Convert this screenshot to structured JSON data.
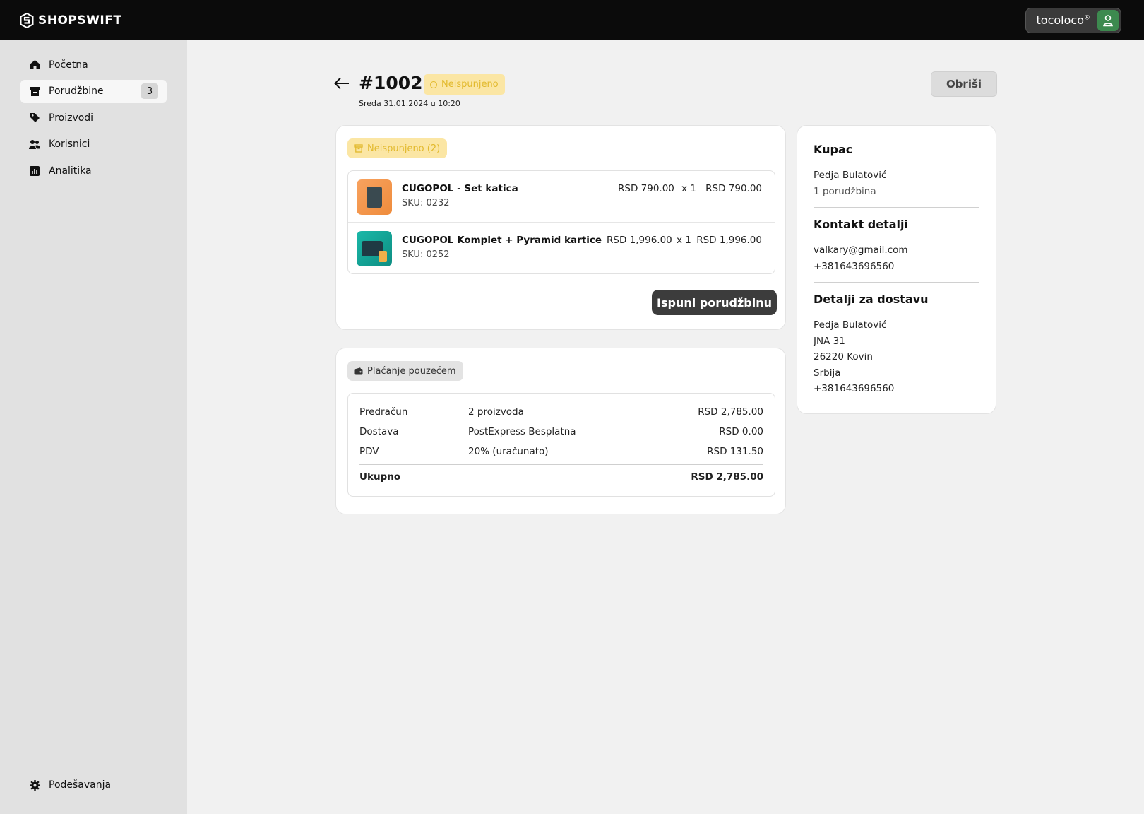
{
  "brand": {
    "name": "SHOPSWIFT"
  },
  "user": {
    "name": "tocoloco",
    "mark": "®"
  },
  "sidebar": {
    "items": [
      {
        "label": "Početna",
        "icon": "home-icon"
      },
      {
        "label": "Porudžbine",
        "icon": "archive-icon",
        "count": "3",
        "active": true
      },
      {
        "label": "Proizvodi",
        "icon": "tag-icon"
      },
      {
        "label": "Korisnici",
        "icon": "users-icon"
      },
      {
        "label": "Analitika",
        "icon": "chart-icon"
      }
    ],
    "settings": {
      "label": "Podešavanja",
      "icon": "gear-icon"
    }
  },
  "order": {
    "number": "#1002",
    "status": "Neispunjeno",
    "date": "Sreda 31.01.2024 u 10:20",
    "delete_label": "Obriši"
  },
  "items_card": {
    "pill": "Neispunjeno (2)",
    "items": [
      {
        "name": "CUGOPOL - Set katica",
        "sku": "SKU: 0232",
        "unit_price": "RSD  790.00",
        "qty": "x  1",
        "total": "RSD 790.00",
        "thumb_color": "#f29a52"
      },
      {
        "name": "CUGOPOL Komplet + Pyramid kartice",
        "sku": "SKU: 0252",
        "unit_price": "RSD  1,996.00",
        "qty": "x  1",
        "total": "RSD 1,996.00",
        "thumb_color": "#14a89a"
      }
    ],
    "fulfill_label": "Ispuni porudžbinu"
  },
  "payment_card": {
    "pill": "Plaćanje pouzećem",
    "rows": [
      {
        "label": "Predračun",
        "detail": "2 proizvoda",
        "amount": "RSD 2,785.00"
      },
      {
        "label": "Dostava",
        "detail": "PostExpress Besplatna",
        "amount": "RSD 0.00"
      },
      {
        "label": "PDV",
        "detail": "20% (uračunato)",
        "amount": "RSD 131.50"
      }
    ],
    "total": {
      "label": "Ukupno",
      "amount": "RSD 2,785.00"
    }
  },
  "customer": {
    "title": "Kupac",
    "name": "Pedja Bulatović",
    "orders": "1 porudžbina",
    "contact_title": "Kontakt detalji",
    "email": "valkary@gmail.com",
    "phone": "+381643696560",
    "shipping_title": "Detalji za dostavu",
    "shipping": [
      "Pedja Bulatović",
      "JNA 31",
      "26220 Kovin",
      "Srbija",
      "+381643696560"
    ]
  },
  "colors": {
    "accent_yellow": "#fbe6a4",
    "status_text": "#e2b92c",
    "avatar_green": "#3d8a4f",
    "topbar": "#0b0b0b"
  }
}
